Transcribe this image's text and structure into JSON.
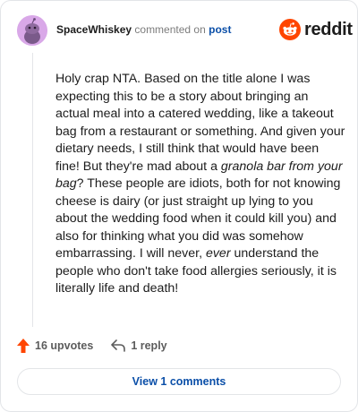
{
  "header": {
    "username": "SpaceWhiskey",
    "action_text": "commented on",
    "target_link": "post"
  },
  "logo": {
    "word": "reddit",
    "icon": "reddit-alien-icon",
    "brand_color": "#ff4500"
  },
  "comment": {
    "p1": "Holy crap NTA. Based on the title alone I was expecting this to be a story about bringing an actual meal into a catered wedding, like a takeout bag from a restaurant or something. And given your dietary needs, I still think that would have been fine! But they're mad about a ",
    "em1": "granola bar from your bag",
    "p2": "? These people are idiots, both for not knowing cheese is dairy (or just straight up lying to you about the wedding food when it could kill you) and also for thinking what you did was somehow embarrassing. I will never, ",
    "em2": "ever",
    "p3": " understand the people who don't take food allergies seriously, it is literally life and death!"
  },
  "actions": {
    "upvotes_label": "16 upvotes",
    "upvote_icon": "upvote-arrow-icon",
    "upvote_color": "#ff4500",
    "reply_label": "1 reply",
    "reply_icon": "reply-arrow-icon"
  },
  "footer": {
    "view_comments_label": "View 1 comments",
    "link_color": "#0b4fa8"
  }
}
